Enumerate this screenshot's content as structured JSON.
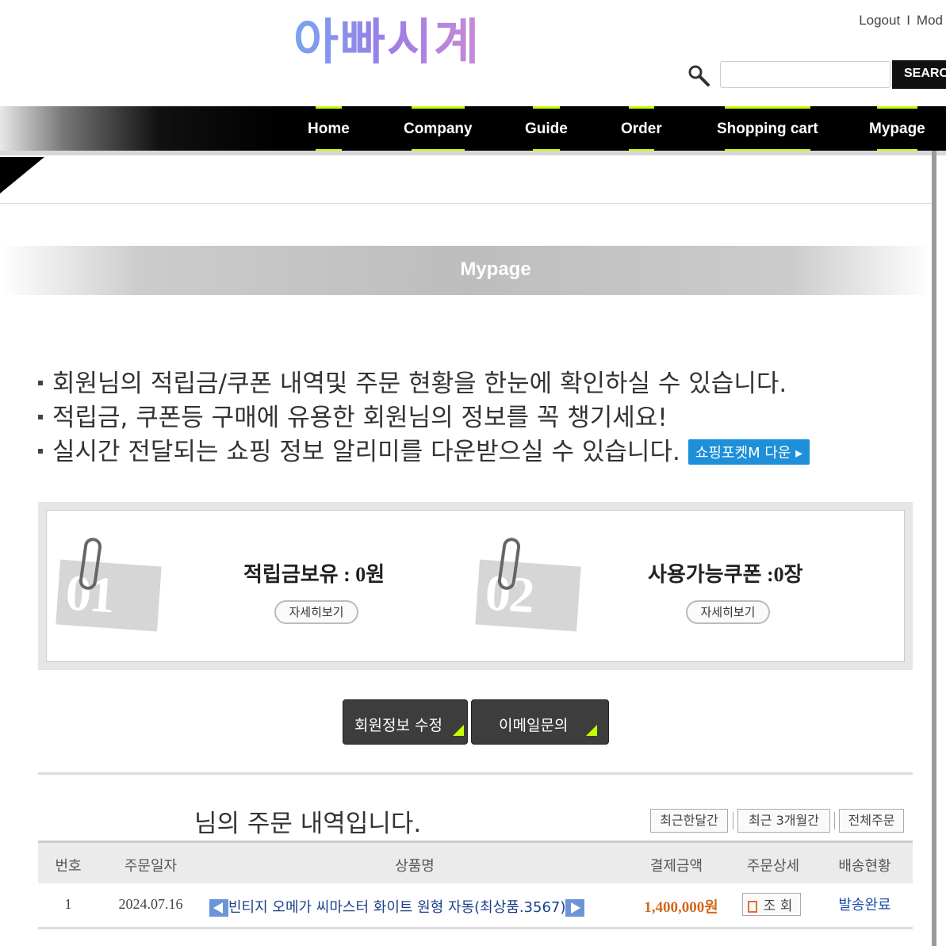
{
  "header": {
    "logo_text": "아빠시계",
    "top_links": {
      "logout": "Logout",
      "separator": "I",
      "modify": "Mod"
    },
    "search": {
      "placeholder": "",
      "button_label": "SEARC"
    }
  },
  "nav": {
    "items": [
      {
        "label": "Home"
      },
      {
        "label": "Company"
      },
      {
        "label": "Guide"
      },
      {
        "label": "Order"
      },
      {
        "label": "Shopping cart"
      },
      {
        "label": "Mypage"
      }
    ]
  },
  "page_title": "Mypage",
  "info": {
    "lines": [
      "회원님의 적립금/쿠폰 내역및 주문 현황을 한눈에 확인하실 수 있습니다.",
      "적립금, 쿠폰등 구매에 유용한 회원님의 정보를 꼭 챙기세요!",
      "실시간 전달되는 쇼핑 정보 알리미를 다운받으실 수 있습니다."
    ],
    "app_button": "쇼핑포켓M 다운 ▸"
  },
  "summary": {
    "points": {
      "badge": "01",
      "label": "적립금보유 : 0원",
      "detail_button": "자세히보기"
    },
    "coupons": {
      "badge": "02",
      "label": "사용가능쿠폰 :0장",
      "detail_button": "자세히보기"
    }
  },
  "actions": {
    "edit_member": "회원정보 수정",
    "email_inquiry": "이메일문의"
  },
  "orders": {
    "title": "님의 주문 내역입니다.",
    "filters": [
      "최근한달간",
      "최근 3개월간",
      "전체주문"
    ],
    "columns": [
      "번호",
      "주문일자",
      "상품명",
      "결제금액",
      "주문상세",
      "배송현황"
    ],
    "rows": [
      {
        "no": "1",
        "date": "2024.07.16",
        "product": "빈티지 오메가 씨마스터 화이트 원형 자동(최상품.3567)",
        "amount": "1,400,000원",
        "detail_button": "조 회",
        "status": "발송완료"
      }
    ]
  },
  "colors": {
    "accent_green": "#c6ff00",
    "nav_bg": "#000000",
    "app_button_bg": "#1e8fd8",
    "price": "#d2691e",
    "status_link": "#1b4fa8"
  }
}
